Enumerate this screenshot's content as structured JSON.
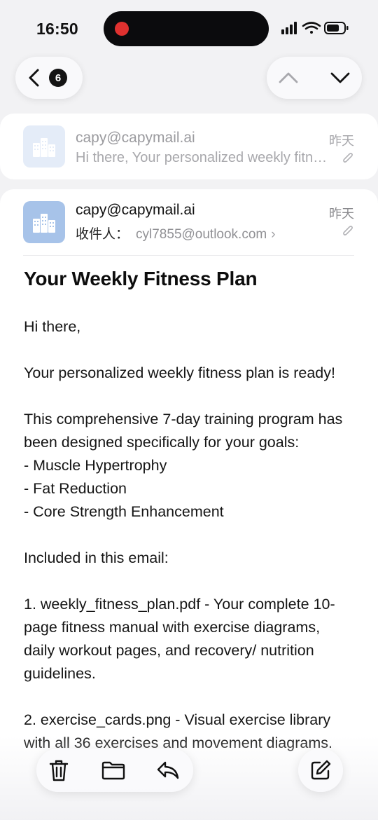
{
  "status_bar": {
    "time": "16:50"
  },
  "nav": {
    "back_count": "6"
  },
  "thread": {
    "collapsed_message": {
      "sender": "capy@capymail.ai",
      "date": "昨天",
      "preview": "Hi there, Your personalized weekly fitness plan is ready!"
    },
    "open_message": {
      "sender": "capy@capymail.ai",
      "date": "昨天",
      "to_label": "收件人：",
      "to_address": "cyl7855@outlook.com",
      "to_chevron": "›",
      "subject": "Your Weekly Fitness Plan",
      "body": [
        "Hi there,",
        "",
        "Your personalized weekly fitness plan is ready!",
        "",
        "This comprehensive 7-day training program has been designed specifically for your goals:",
        "- Muscle Hypertrophy",
        "- Fat Reduction",
        "- Core Strength Enhancement",
        "",
        "Included in this email:",
        "",
        "1. weekly_fitness_plan.pdf - Your complete 10-page fitness manual with exercise diagrams, daily workout pages, and recovery/ nutrition guidelines.",
        "",
        "2. exercise_cards.png - Visual exercise library with all 36 exercises and movement diagrams."
      ]
    }
  },
  "toolbar": {
    "icons": [
      "trash-icon",
      "folder-icon",
      "reply-icon",
      "compose-icon"
    ]
  },
  "colors": {
    "avatar_light": "#e4ecf8",
    "avatar_blue": "#a7c3e9",
    "recording_dot": "#e0312f"
  }
}
